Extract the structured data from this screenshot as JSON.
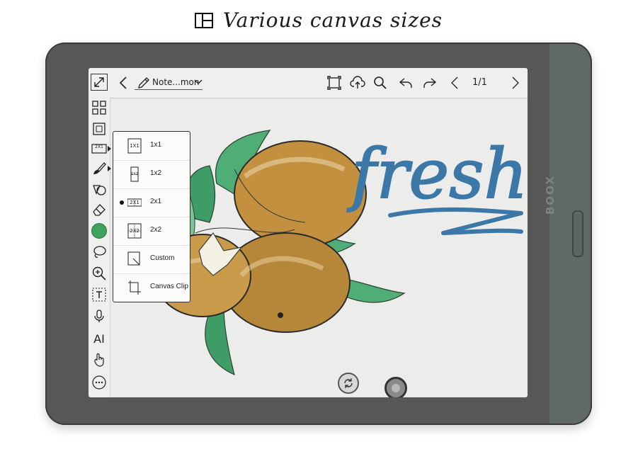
{
  "banner": {
    "title": "Various canvas sizes"
  },
  "device": {
    "brand": "BOOX"
  },
  "topbar": {
    "doc_title": "Note...mon",
    "page_indicator": "1/1"
  },
  "canvas_menu": {
    "items": [
      {
        "icon_text": "1X1",
        "label": "1x1",
        "selected": false
      },
      {
        "icon_text": "1X2",
        "label": "1x2",
        "selected": false
      },
      {
        "icon_text": "2X1",
        "label": "2x1",
        "selected": true
      },
      {
        "icon_text": "2X2",
        "label": "2x2",
        "selected": false
      },
      {
        "icon_text": "",
        "label": "Custom",
        "selected": false
      },
      {
        "icon_text": "",
        "label": "Canvas Clip",
        "selected": false
      }
    ]
  },
  "leftbar": {
    "canvas_size_icon_text": "2X1",
    "pen_color": "#3fa25e",
    "ai_label": "AI"
  },
  "drawing": {
    "text": "fresh",
    "text_color": "#3b78a8"
  }
}
